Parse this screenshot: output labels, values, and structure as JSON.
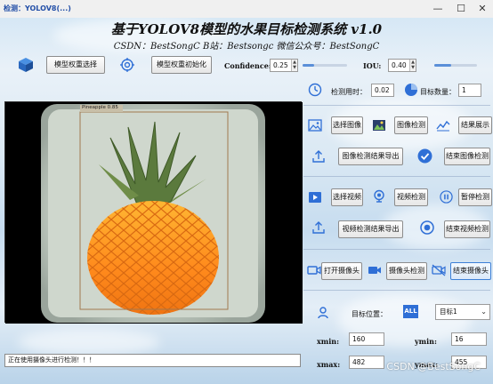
{
  "window": {
    "title": "检测：YOLOV8(...)",
    "controls": [
      "—",
      "☐",
      "✕"
    ]
  },
  "header": {
    "title": "基于YOLOV8模型的水果目标检测系统 v1.0",
    "subtitle": "CSDN：BestSongC   B站：Bestsongc   微信公众号：BestSongC"
  },
  "toolbar": {
    "select_model_label": "模型权重选择",
    "init_model_label": "模型权重初始化",
    "confidence_label": "Confidence:",
    "confidence_value": "0.25",
    "confidence_level": 0.25,
    "iou_label": "IOU:",
    "iou_value": "0.40",
    "iou_level": 0.4
  },
  "stats": {
    "time_label": "检测用时：",
    "time_value": "0.02",
    "count_label": "目标数量：",
    "count_value": "1"
  },
  "image_section": {
    "select_label": "选择图像",
    "detect_label": "图像检测",
    "show_result_label": "结果展示",
    "export_label": "图像检测结果导出",
    "stop_label": "结束图像检测"
  },
  "video_section": {
    "select_label": "选择视频",
    "detect_label": "视频检测",
    "pause_label": "暂停检测",
    "export_label": "视频检测结果导出",
    "stop_label": "结束视频检测"
  },
  "camera_section": {
    "open_label": "打开摄像头",
    "detect_label": "摄像头检测",
    "stop_label": "结束摄像头"
  },
  "target_section": {
    "position_label": "目标位置：",
    "all_badge": "ALL",
    "selected_target": "目标1",
    "xmin_label": "xmin:",
    "xmin_value": "160",
    "ymin_label": "ymin:",
    "ymin_value": "16",
    "xmax_label": "xmax:",
    "xmax_value": "482",
    "ymax_label": "ymax:",
    "ymax_value": "455"
  },
  "detection": {
    "box_label": "Pineapple  0.85"
  },
  "status": {
    "text": "正在使用摄像头进行检测！！！"
  },
  "watermark": "CSDN @BestSongC",
  "colors": {
    "accent": "#2f6fd6",
    "slider": "#5a8fd8"
  }
}
